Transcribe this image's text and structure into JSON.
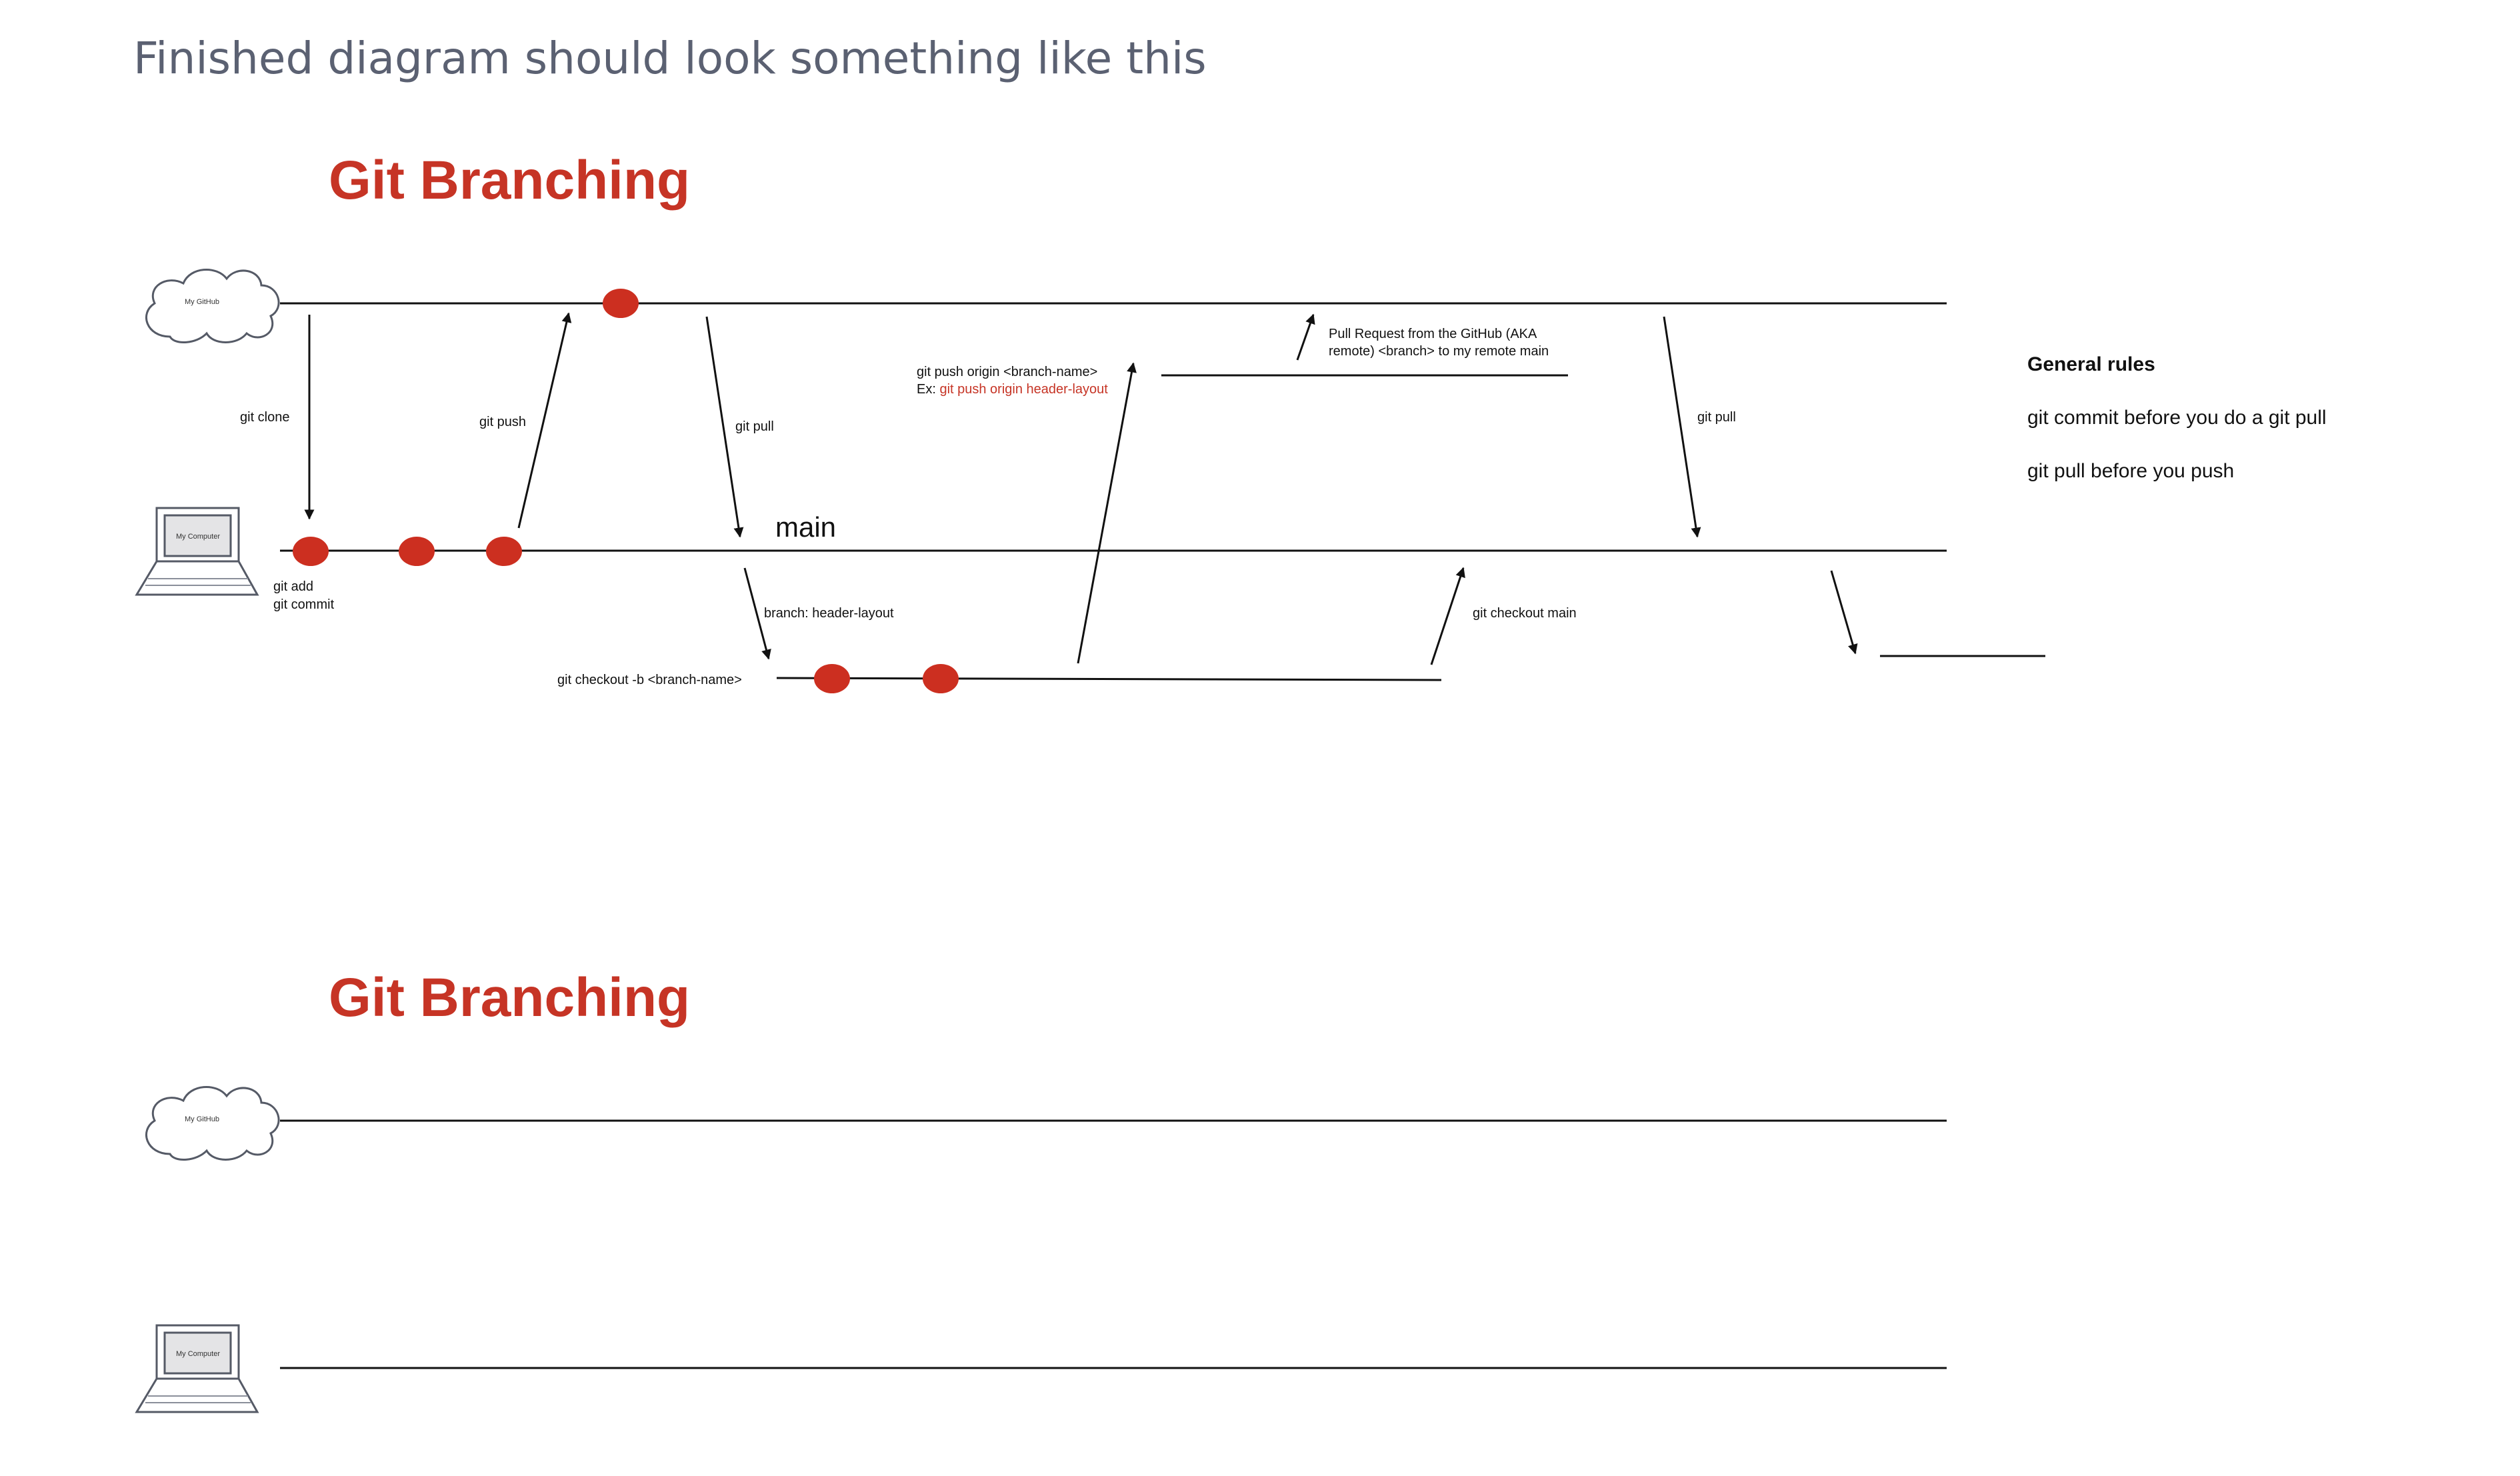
{
  "page": {
    "heading": "Finished diagram should look something like this"
  },
  "diagram1": {
    "title": "Git Branching",
    "github_icon_label": "My GitHub",
    "computer_icon_label": "My Computer",
    "labels": {
      "git_clone": "git clone",
      "git_push": "git push",
      "git_pull_1": "git pull",
      "git_add": "git add",
      "git_commit": "git commit",
      "main": "main",
      "branch_header_layout": "branch: header-layout",
      "git_checkout_b": "git checkout -b <branch-name>",
      "git_push_origin": "git push origin <branch-name>",
      "ex_prefix": "Ex: ",
      "ex_command": "git push origin header-layout",
      "pull_request_1": "Pull Request from the GitHub (AKA",
      "pull_request_2": "remote) <branch> to my remote main",
      "git_checkout_main": "git checkout main",
      "git_pull_2": "git pull"
    }
  },
  "rules": {
    "heading": "General rules",
    "items": [
      "git commit before you do a git pull",
      "git pull before you push"
    ]
  },
  "diagram2": {
    "title": "Git Branching",
    "github_icon_label": "My GitHub",
    "computer_icon_label": "My Computer"
  },
  "colors": {
    "accent": "#c63425",
    "commit": "#cc2f20",
    "heading_gray": "#5b6172",
    "line": "#111111"
  }
}
